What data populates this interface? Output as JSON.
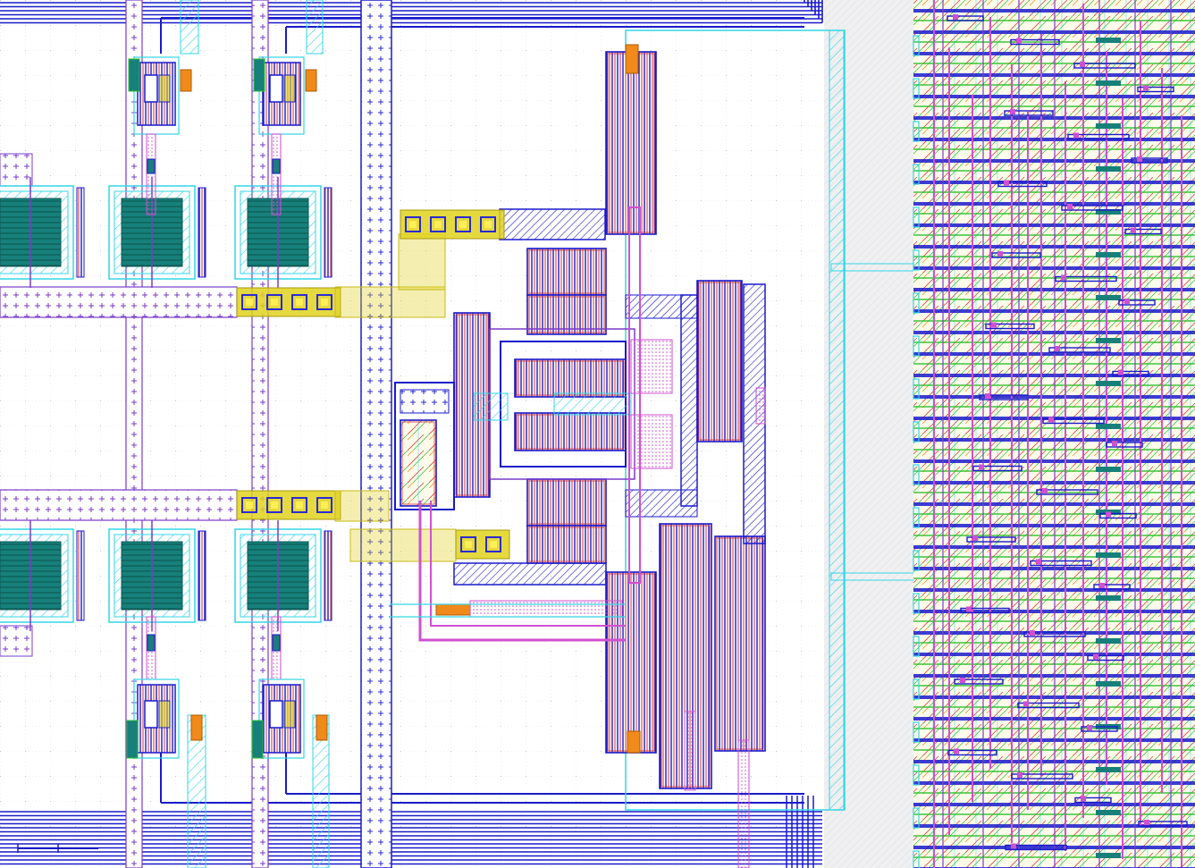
{
  "view": {
    "kind": "ic-layout-editor-canvas",
    "grid": "dotted"
  },
  "colors": {
    "background": "#ffffff",
    "grid": "#b9b9b9",
    "metal1": "#1a1acc",
    "metal2": "#7a3cc8",
    "via": "#e0197a",
    "diffusion": "#00b0b0",
    "poly": "#d03030",
    "nwell": "#33d6e6",
    "contact_pad": "#e0d21e",
    "contact_hole": "#2b2bd0",
    "resistor_body": "#17807a",
    "orange_cut": "#f08a1a",
    "green_impl": "#2ec02e",
    "pink_route": "#d050d0",
    "std_cells": "#e04040"
  },
  "layers": {
    "cells": [
      {
        "id": "left-upper-array",
        "kind": "resistor-array"
      },
      {
        "id": "left-lower-array",
        "kind": "resistor-array"
      },
      {
        "id": "center-analog",
        "kind": "transistor-cluster"
      },
      {
        "id": "right-digital",
        "kind": "standard-cell-block"
      }
    ]
  }
}
